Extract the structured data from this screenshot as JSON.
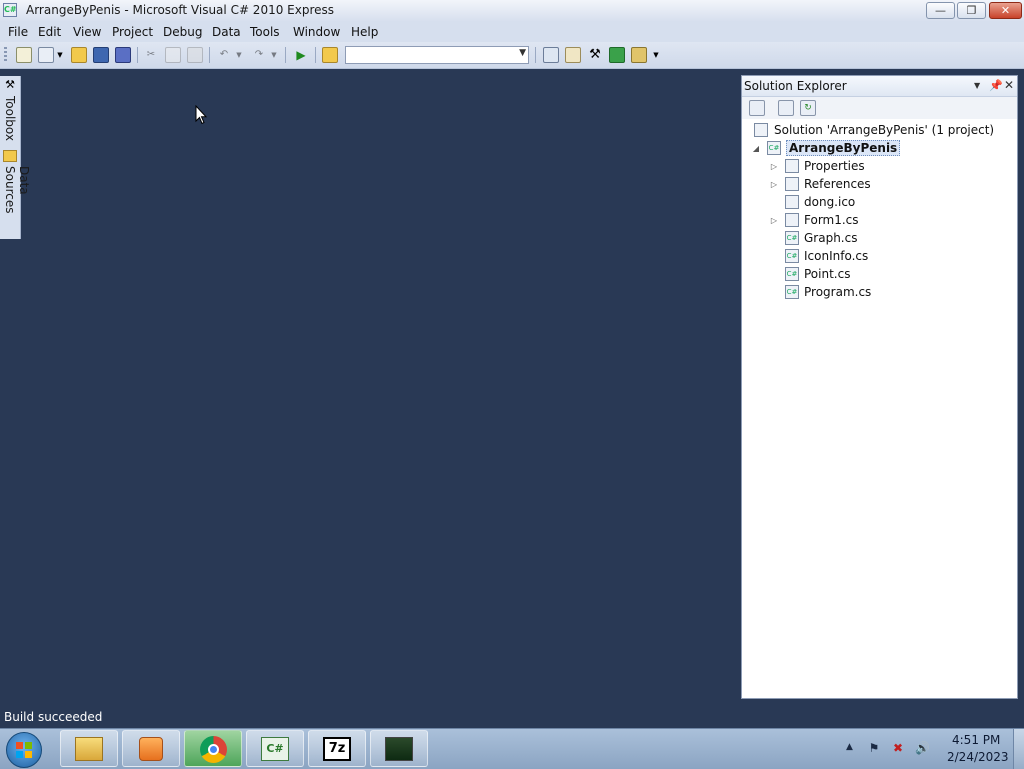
{
  "window": {
    "title": "ArrangeByPenis - Microsoft Visual C# 2010 Express",
    "minimize_icon": "minimize-icon",
    "maximize_icon": "restore-icon",
    "close_icon": "close-icon"
  },
  "menu": {
    "items": [
      "File",
      "Edit",
      "View",
      "Project",
      "Debug",
      "Data",
      "Tools",
      "Window",
      "Help"
    ]
  },
  "toolbar": {
    "config_value": "",
    "icons": [
      "new-project-icon",
      "add-item-icon",
      "open-icon",
      "save-icon",
      "save-all-icon",
      "cut-icon",
      "copy-icon",
      "paste-icon",
      "undo-icon",
      "redo-icon",
      "start-debugging-icon",
      "find-in-files-icon",
      "solution-explorer-icon",
      "properties-icon",
      "toolbox-icon",
      "object-browser-icon",
      "start-page-icon"
    ]
  },
  "side_panels": {
    "toolbox": "Toolbox",
    "data_sources": "Data Sources"
  },
  "solution_explorer": {
    "title": "Solution Explorer",
    "solution_label": "Solution 'ArrangeByPenis' (1 project)",
    "project_label": "ArrangeByPenis",
    "items": [
      {
        "label": "Properties",
        "expandable": true,
        "icon": "properties-folder-icon"
      },
      {
        "label": "References",
        "expandable": true,
        "icon": "references-folder-icon"
      },
      {
        "label": "dong.ico",
        "expandable": false,
        "icon": "icon-file-icon"
      },
      {
        "label": "Form1.cs",
        "expandable": true,
        "icon": "form-file-icon"
      },
      {
        "label": "Graph.cs",
        "expandable": false,
        "icon": "csharp-file-icon"
      },
      {
        "label": "IconInfo.cs",
        "expandable": false,
        "icon": "csharp-file-icon"
      },
      {
        "label": "Point.cs",
        "expandable": false,
        "icon": "csharp-file-icon"
      },
      {
        "label": "Program.cs",
        "expandable": false,
        "icon": "csharp-file-icon"
      }
    ]
  },
  "status": {
    "text": "Build succeeded"
  },
  "taskbar": {
    "apps": [
      "windows-explorer",
      "windows-media-player",
      "google-chrome",
      "visual-csharp-express",
      "7-zip",
      "remote-desktop"
    ],
    "clock_time": "4:51 PM",
    "clock_date": "2/24/2023"
  },
  "colors": {
    "workspace": "#293955",
    "chrome_bar": "#d6dfee",
    "taskbar": "#9fb6d2"
  }
}
